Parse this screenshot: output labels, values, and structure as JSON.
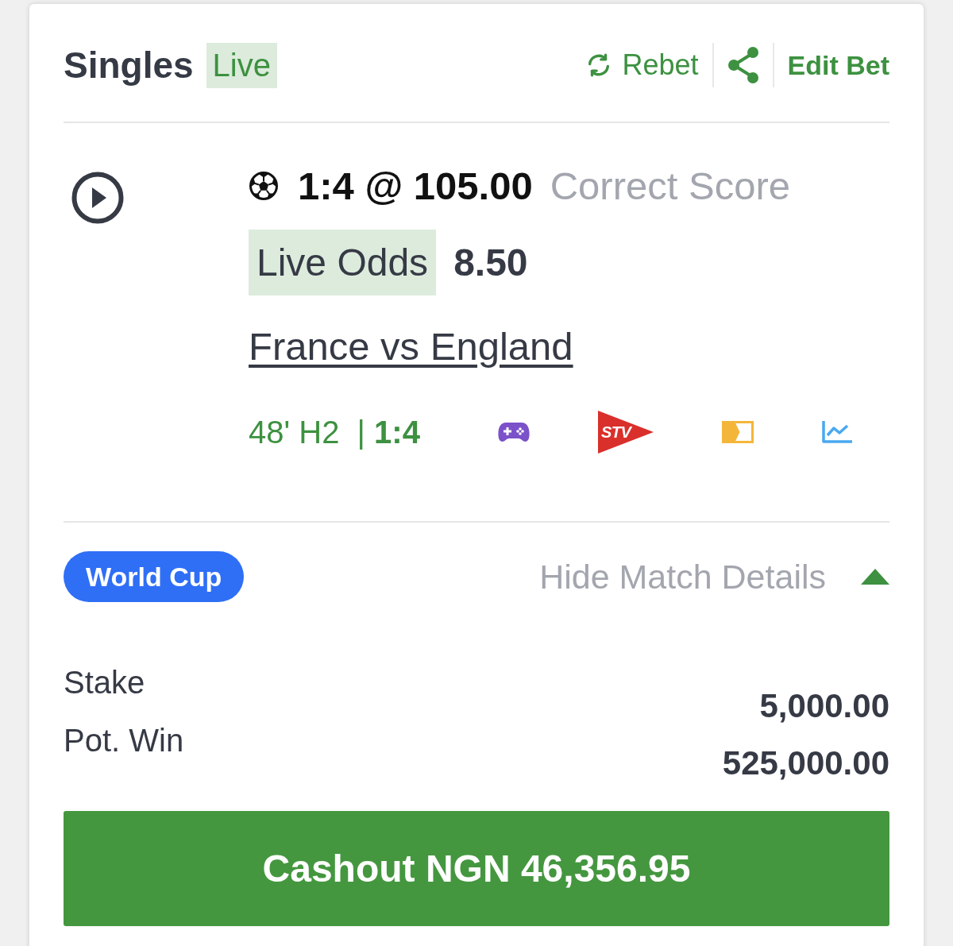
{
  "header": {
    "title": "Singles",
    "badge": "Live",
    "actions": [
      {
        "kind": "rebet",
        "label": "Rebet"
      },
      {
        "kind": "share"
      },
      {
        "kind": "edit",
        "label": "Edit Bet"
      }
    ]
  },
  "selection": {
    "pick": "1:4 @ 105.00",
    "market": "Correct Score",
    "live_odds_label": "Live Odds",
    "live_odds": "8.50",
    "match": "France vs England",
    "status": "48' H2  | **1:4**",
    "tools": [
      {
        "kind": "game"
      },
      {
        "kind": "stream",
        "label": "STV"
      },
      {
        "kind": "ticket"
      },
      {
        "kind": "stats"
      }
    ]
  },
  "details": {
    "competition": "World Cup",
    "toggle_label": "Hide Match Details",
    "expanded": true
  },
  "summary": [
    {
      "label": "Stake",
      "value": "5,000.00"
    },
    {
      "label": "Pot. Win",
      "value": "525,000.00"
    }
  ],
  "cashout": {
    "label": "Cashout NGN 46,356.95"
  }
}
